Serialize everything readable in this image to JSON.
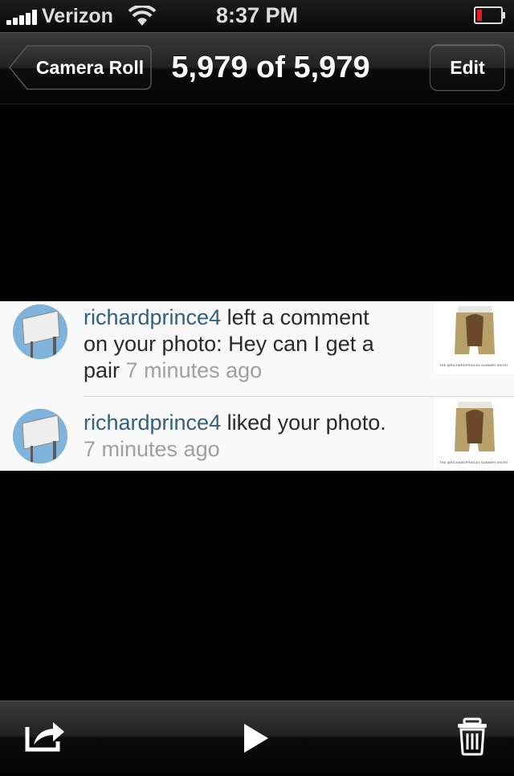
{
  "status_bar": {
    "carrier": "Verizon",
    "time": "8:37 PM",
    "battery_color": "#e02020"
  },
  "nav_bar": {
    "back_label": "Camera Roll",
    "title": "5,979 of 5,979",
    "edit_label": "Edit"
  },
  "photo": {
    "notifications": [
      {
        "username": "richardprince4",
        "message_line1": " left a comment",
        "message_line2": "on your photo: Hey can I get a",
        "message_line3": "pair",
        "time_ago": "7 minutes ago",
        "thumb_caption": "THE @RICHARDPRINCE4 SUMMER SHORT"
      },
      {
        "username": "richardprince4",
        "message_line1": " liked your photo.",
        "time_ago": "7 minutes ago",
        "thumb_caption": "THE @RICHARDPRINCE4 SUMMER SHORT"
      }
    ]
  },
  "toolbar": {
    "share_icon": "share-icon",
    "play_icon": "play-icon",
    "trash_icon": "trash-icon"
  }
}
